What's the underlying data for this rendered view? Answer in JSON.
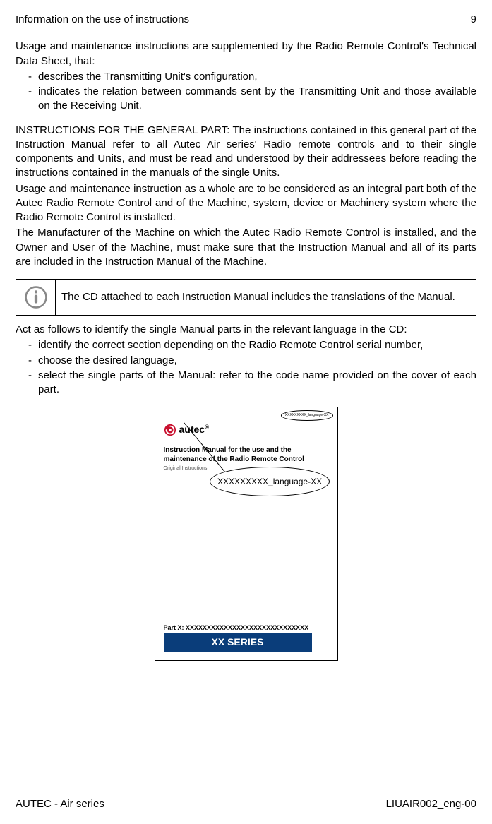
{
  "header": {
    "left": "Information on the use of instructions",
    "right": "9"
  },
  "intro": "Usage and maintenance instructions are supplemented by the Radio Remote Control's Technical Data Sheet, that:",
  "list1": [
    "describes the Transmitting Unit's configuration,",
    "indicates the relation between commands sent by the Transmitting Unit and those available on the Receiving Unit."
  ],
  "p2": "INSTRUCTIONS FOR THE GENERAL PART: The instructions contained in this general part of the Instruction Manual refer to all Autec Air series' Radio remote controls and to their single components and Units, and must be read and understood by their addressees before reading the instructions contained in the manuals of the single Units.",
  "p3": "Usage and maintenance instruction as a whole are to be considered as an integral part both of the Autec Radio Remote Control and of the Machine, system, device or Machinery system where the Radio Remote Control is installed.",
  "p4": "The Manufacturer of the Machine on which the Autec Radio Remote Control is installed, and the Owner and User of the Machine, must make sure that the Instruction Manual and all of its parts are included in the Instruction Manual of the Machine.",
  "info_note": "The CD attached to each Instruction Manual includes the translations of the Manual.",
  "p5": "Act as follows to identify the single Manual parts in the relevant language in the CD:",
  "list2": [
    "identify the correct section depending on the Radio Remote Control serial number,",
    "choose the desired language,",
    "select the single parts of the Manual: refer to the code name provided on the cover of each part."
  ],
  "cover": {
    "logo_text": "autec",
    "small_code": "XXXXXXXXX_language-XX",
    "title": "Instruction Manual for the use and the maintenance of the Radio Remote Control",
    "sub": "Original Instructions",
    "part": "Part X: XXXXXXXXXXXXXXXXXXXXXXXXXXXXX",
    "series": "XX SERIES"
  },
  "callout": "XXXXXXXXX_language-XX",
  "footer": {
    "left": "AUTEC - Air series",
    "right": "LIUAIR002_eng-00"
  }
}
